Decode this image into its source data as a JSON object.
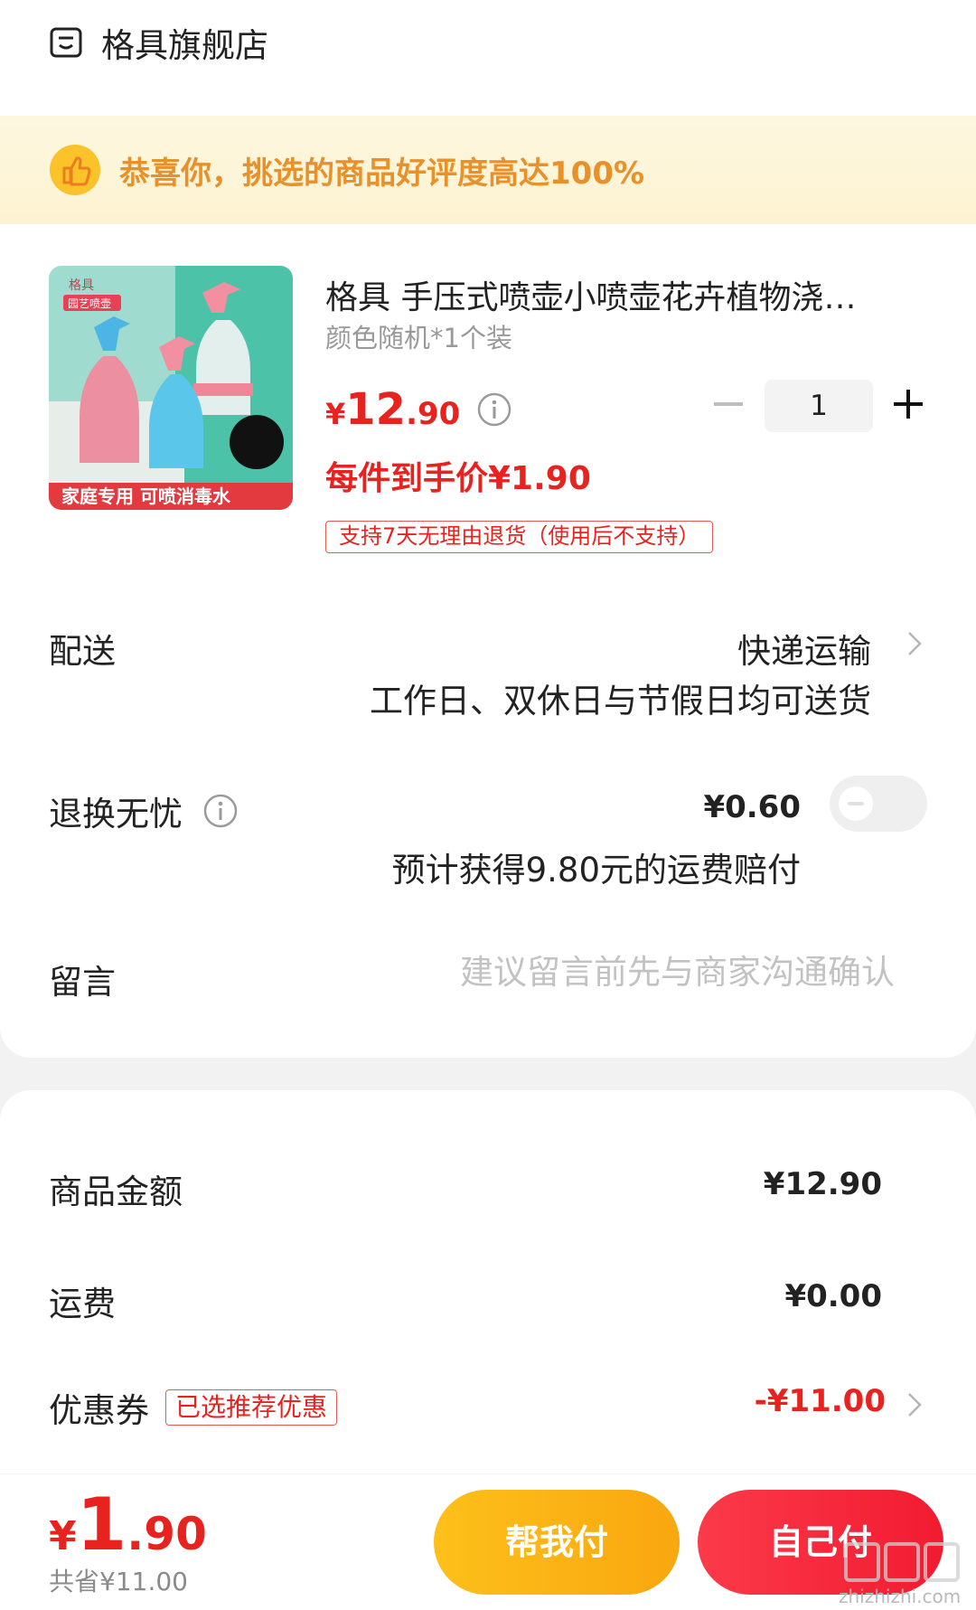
{
  "store": {
    "name": "格具旗舰店",
    "icon": "store-icon"
  },
  "banner": {
    "text": "恭喜你，挑选的商品好评度高达100%",
    "icon": "thumbs-up-icon",
    "accent": "#e8912b"
  },
  "product": {
    "image_labels": {
      "brand": "格具",
      "category": "园艺喷壶",
      "caption": "家庭专用 可喷消毒水"
    },
    "title": "格具 手压式喷壶小喷壶花卉植物浇…",
    "spec": "颜色随机*1个装",
    "price_yen": "¥",
    "price_int": "12",
    "price_dec": ".90",
    "quantity": "1",
    "unit_price": "每件到手价¥1.90",
    "return_policy": "支持7天无理由退货（使用后不支持）"
  },
  "delivery": {
    "label": "配送",
    "method": "快递运输",
    "note": "工作日、双休日与节假日均可送货"
  },
  "return_insurance": {
    "label": "退换无忧",
    "price": "¥0.60",
    "note": "预计获得9.80元的运费赔付",
    "enabled": false
  },
  "message": {
    "label": "留言",
    "placeholder": "建议留言前先与商家沟通确认"
  },
  "summary": {
    "goods_label": "商品金额",
    "goods_value": "¥12.90",
    "freight_label": "运费",
    "freight_value": "¥0.00",
    "coupon_label": "优惠券",
    "coupon_tag": "已选推荐优惠",
    "coupon_value": "-¥11.00"
  },
  "footer": {
    "total_yen": "¥",
    "total_int": "1",
    "total_dec": ".90",
    "saved": "共省¥11.00",
    "help_pay": "帮我付",
    "self_pay": "自己付"
  },
  "watermark": "zhizhizhi.com",
  "colors": {
    "price_red": "#e8231f",
    "help_pay_yellow": "#fdc01a",
    "self_pay_red": "#f21b30"
  }
}
